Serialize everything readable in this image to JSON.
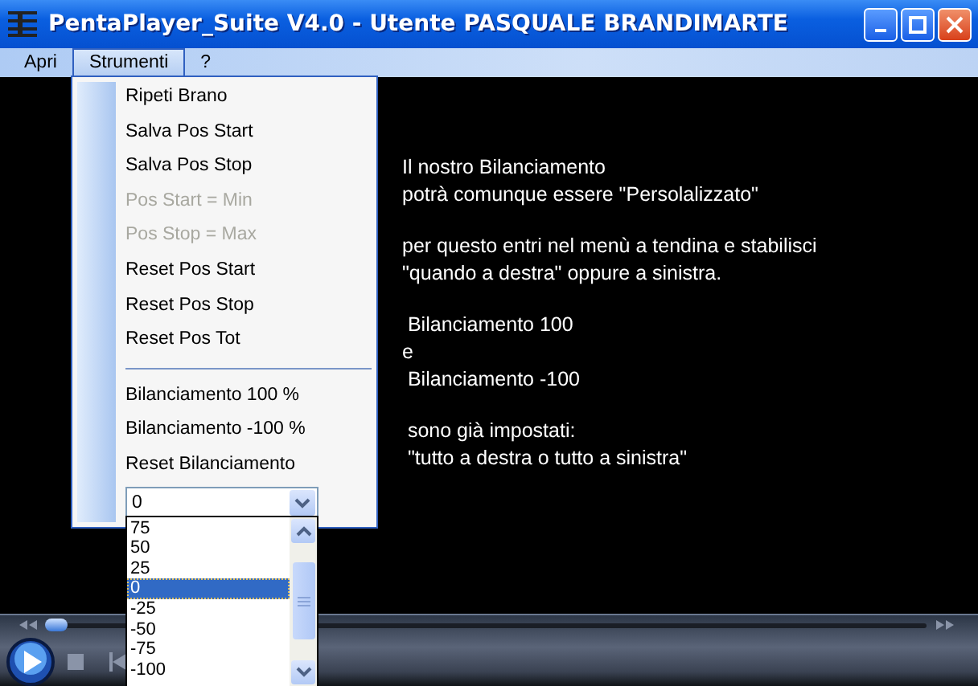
{
  "window": {
    "title": "PentaPlayer_Suite V4.0 - Utente PASQUALE BRANDIMARTE"
  },
  "menubar": [
    {
      "label": "Apri",
      "selected": false
    },
    {
      "label": "Strumenti",
      "selected": true
    },
    {
      "label": "?",
      "selected": false
    }
  ],
  "strumenti_menu": [
    {
      "kind": "item",
      "label": "Ripeti Brano",
      "disabled": false
    },
    {
      "kind": "item",
      "label": "Salva Pos Start",
      "disabled": false
    },
    {
      "kind": "item",
      "label": "Salva Pos Stop",
      "disabled": false
    },
    {
      "kind": "item",
      "label": "Pos Start = Min",
      "disabled": true
    },
    {
      "kind": "item",
      "label": "Pos Stop = Max",
      "disabled": true
    },
    {
      "kind": "item",
      "label": "Reset Pos Start",
      "disabled": false
    },
    {
      "kind": "item",
      "label": "Reset Pos Stop",
      "disabled": false
    },
    {
      "kind": "item",
      "label": "Reset Pos Tot",
      "disabled": false
    },
    {
      "kind": "separator"
    },
    {
      "kind": "item",
      "label": "Bilanciamento 100 %",
      "disabled": false
    },
    {
      "kind": "item",
      "label": "Bilanciamento -100 %",
      "disabled": false
    },
    {
      "kind": "item",
      "label": "Reset Bilanciamento",
      "disabled": false
    },
    {
      "kind": "combo",
      "value": "0",
      "options": [
        {
          "label": "75",
          "selected": false
        },
        {
          "label": "50",
          "selected": false
        },
        {
          "label": "25",
          "selected": false
        },
        {
          "label": "0",
          "selected": true
        },
        {
          "label": "-25",
          "selected": false
        },
        {
          "label": "-50",
          "selected": false
        },
        {
          "label": "-75",
          "selected": false
        },
        {
          "label": "-100",
          "selected": false
        }
      ]
    }
  ],
  "message": [
    [
      "Il nostro Bilanciamento",
      "potrà comunque essere \"Persolalizzato\""
    ],
    [
      "per questo entri nel menù a tendina e stabilisci",
      "\"quando a destra\" oppure a sinistra."
    ],
    [
      " Bilanciamento 100",
      "e",
      " Bilanciamento -100"
    ],
    [
      " sono già impostati:",
      " \"tutto a destra o tutto a sinistra\""
    ]
  ],
  "player": {
    "seek": {
      "level": 0.01
    }
  }
}
